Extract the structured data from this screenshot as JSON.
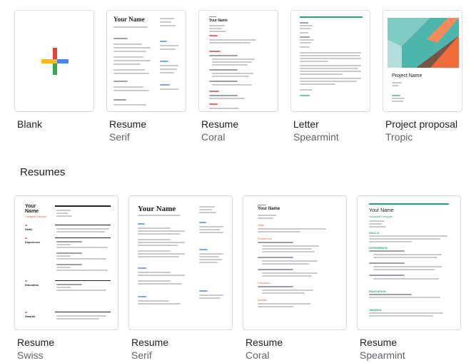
{
  "colors": {
    "coral": "#e06a4e",
    "spearmint": "#2e9e79",
    "swiss": "#e8542b",
    "google_blue": "#4285f4",
    "google_red": "#ea4335",
    "google_yellow": "#fbbc05",
    "google_green": "#34a853"
  },
  "top_row": [
    {
      "title": "Blank",
      "subtitle": ""
    },
    {
      "title": "Resume",
      "subtitle": "Serif"
    },
    {
      "title": "Resume",
      "subtitle": "Coral"
    },
    {
      "title": "Letter",
      "subtitle": "Spearmint"
    },
    {
      "title": "Project proposal",
      "subtitle": "Tropic"
    }
  ],
  "section_title": "Resumes",
  "resumes": [
    {
      "title": "Resume",
      "subtitle": "Swiss"
    },
    {
      "title": "Resume",
      "subtitle": "Serif"
    },
    {
      "title": "Resume",
      "subtitle": "Coral"
    },
    {
      "title": "Resume",
      "subtitle": "Spearmint"
    }
  ],
  "thumbs": {
    "your_name": "Your Name",
    "for_your_name": "Your Name",
    "project_name": "Project Name",
    "swiss_name_line1": "Your",
    "swiss_name_line2": "Name",
    "swiss_role": "Creative Director",
    "swiss_skills": "Skills",
    "swiss_experience": "Experience",
    "swiss_education": "Education",
    "swiss_awards": "Awards",
    "spearmint_role": "Industrial Designer",
    "spearmint_skills": "SKILLS",
    "spearmint_experience": "EXPERIENCE",
    "spearmint_education": "EDUCATION",
    "spearmint_awards": "AWARDS",
    "coral_skills": "Skills",
    "coral_experience": "Experience",
    "coral_education": "Education",
    "coral_awards": "Awards"
  }
}
